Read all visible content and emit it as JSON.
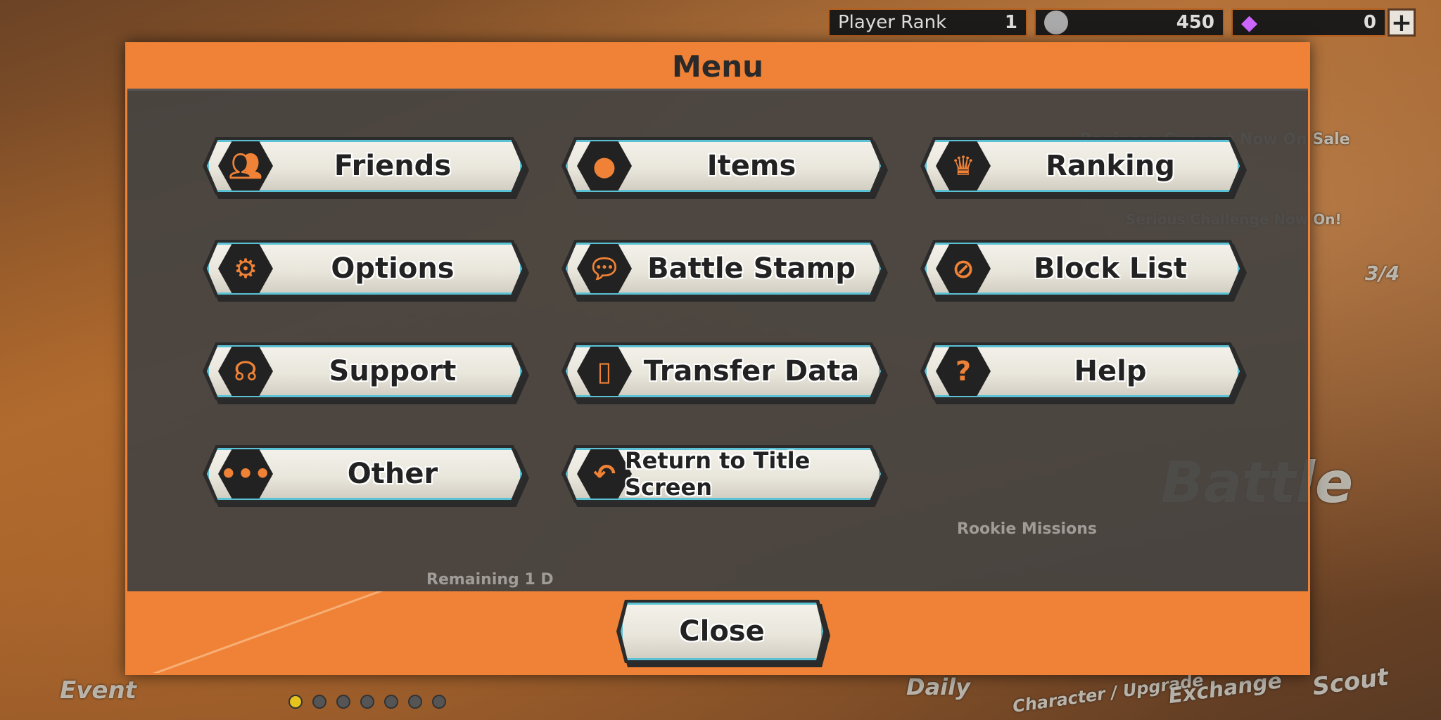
{
  "header": {
    "player_rank_label": "Player Rank",
    "player_rank": "1",
    "coins": "450",
    "gems": "0",
    "add_label": "+"
  },
  "background": {
    "banner_sale": "Beginner Support Now On Sale",
    "banner_challenge": "Serious Challenge Now On!",
    "chest_count": "3/4",
    "remaining": "Remaining 1 D",
    "rookie": "Rookie Missions",
    "battle": "Battle",
    "nav": [
      "Event",
      "Daily",
      "Character / Upgrade",
      "Exchange",
      "Scout"
    ]
  },
  "menu": {
    "title": "Menu",
    "close_label": "Close",
    "items": [
      {
        "label": "Friends",
        "icon": "friends-icon"
      },
      {
        "label": "Items",
        "icon": "bag-icon"
      },
      {
        "label": "Ranking",
        "icon": "trophy-icon"
      },
      {
        "label": "Options",
        "icon": "gear-icon"
      },
      {
        "label": "Battle Stamp",
        "icon": "speech-bubble-icon"
      },
      {
        "label": "Block List",
        "icon": "block-user-icon"
      },
      {
        "label": "Support",
        "icon": "headset-icon"
      },
      {
        "label": "Transfer Data",
        "icon": "phone-transfer-icon"
      },
      {
        "label": "Help",
        "icon": "question-icon"
      },
      {
        "label": "Other",
        "icon": "more-icon"
      },
      {
        "label": "Return to Title Screen",
        "icon": "return-icon"
      }
    ]
  },
  "colors": {
    "accent": "#ef8236",
    "panel": "#464442",
    "button_edge": "#5bc2d6"
  }
}
